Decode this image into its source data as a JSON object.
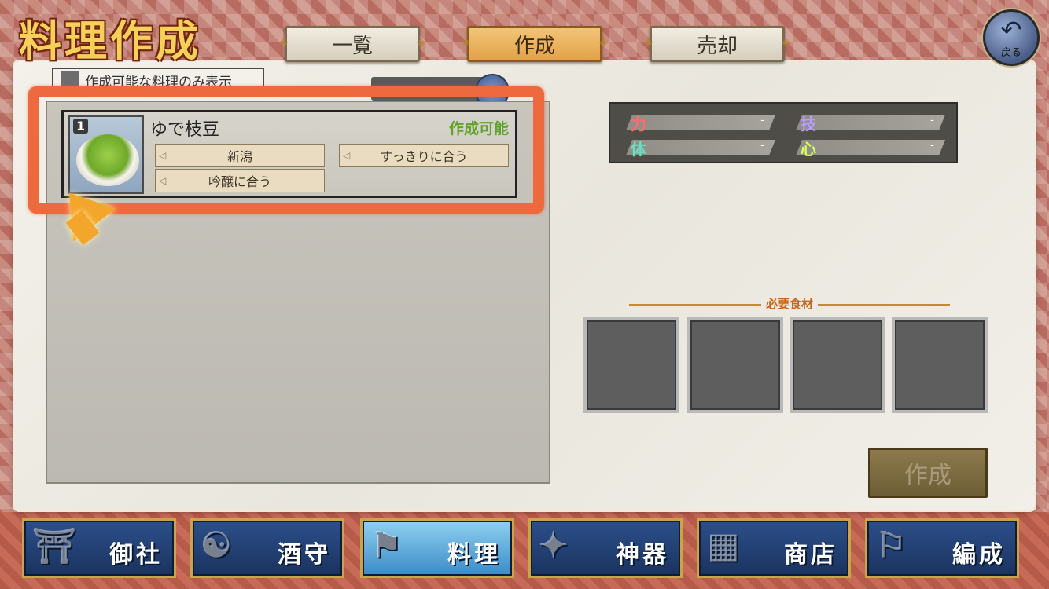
{
  "header": {
    "title": "料理作成",
    "tabs": [
      {
        "label": "一覧",
        "active": false
      },
      {
        "label": "作成",
        "active": true
      },
      {
        "label": "売却",
        "active": false
      }
    ],
    "back_label": "戻る"
  },
  "filter": {
    "label": "作成可能な料理のみ表示",
    "checked": false
  },
  "recipes": [
    {
      "rank": "1",
      "name": "ゆで枝豆",
      "status": "作成可能",
      "tags": [
        "新潟",
        "すっきりに合う",
        "吟醸に合う"
      ]
    }
  ],
  "stats": [
    {
      "key": "力",
      "value": "-",
      "color": "#ff6b6b"
    },
    {
      "key": "技",
      "value": "-",
      "color": "#b99cff"
    },
    {
      "key": "体",
      "value": "-",
      "color": "#6be0c0"
    },
    {
      "key": "心",
      "value": "-",
      "color": "#d8ff5a"
    }
  ],
  "ingredients": {
    "header": "必要食材",
    "slots": 4
  },
  "create_button": "作成",
  "bottom_nav": [
    {
      "label": "御社",
      "icon": "shrine-icon",
      "active": false
    },
    {
      "label": "酒守",
      "icon": "sakemori-icon",
      "active": false
    },
    {
      "label": "料理",
      "icon": "cooking-icon",
      "active": true
    },
    {
      "label": "神器",
      "icon": "sacred-treasure-icon",
      "active": false
    },
    {
      "label": "商店",
      "icon": "shop-icon",
      "active": false
    },
    {
      "label": "編成",
      "icon": "formation-icon",
      "active": false
    }
  ]
}
